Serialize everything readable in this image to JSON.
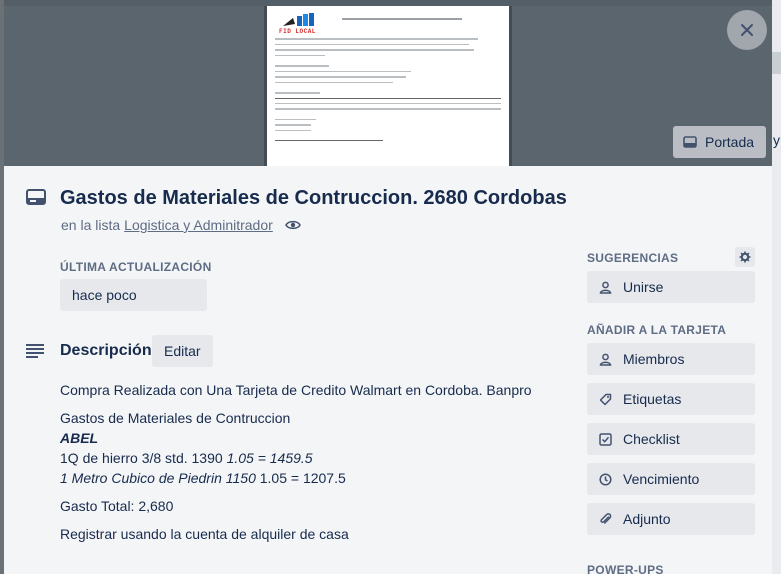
{
  "card": {
    "title": "Gastos de Materiales de Contruccion. 2680 Cordobas",
    "in_list_prefix": "en la lista",
    "list_name": "Logistica y Adminitrador"
  },
  "cover": {
    "button_label": "Portada",
    "doc_brand": "FID LOCAL"
  },
  "last_update": {
    "label": "ÚLTIMA ACTUALIZACIÓN",
    "value": "hace poco"
  },
  "description": {
    "title": "Descripción",
    "edit_label": "Editar",
    "line1": "Compra Realizada con Una Tarjeta de Credito Walmart en Cordoba. Banpro",
    "line2": "Gastos de Materiales de Contruccion",
    "line3": "ABEL",
    "line4_plain": "1Q de hierro 3/8 std. 1390 ",
    "line4_italic": "1.05 = 1459.5",
    "line5_italic": "1 Metro Cubico de Piedrin 1150",
    "line5_plain": " 1.05 = 1207.5",
    "line6": "Gasto Total: 2,680",
    "line7": "Registrar usando la cuenta de alquiler de casa"
  },
  "sidebar": {
    "suggestions_label": "SUGERENCIAS",
    "join_label": "Unirse",
    "add_label": "AÑADIR A LA TARJETA",
    "items": [
      {
        "label": "Miembros",
        "icon": "person-icon"
      },
      {
        "label": "Etiquetas",
        "icon": "tag-icon"
      },
      {
        "label": "Checklist",
        "icon": "checkbox-icon"
      },
      {
        "label": "Vencimiento",
        "icon": "clock-icon"
      },
      {
        "label": "Adjunto",
        "icon": "paperclip-icon"
      }
    ],
    "powerups_label": "POWER-UPS"
  },
  "backdrop": {
    "peek_letter": "y"
  }
}
